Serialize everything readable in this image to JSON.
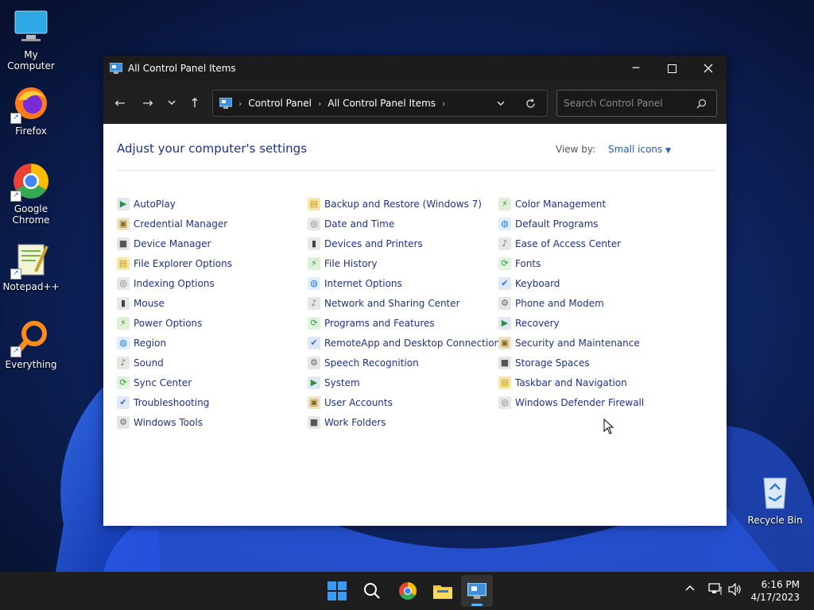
{
  "desktop": {
    "icons": [
      {
        "label": "My Computer"
      },
      {
        "label": "Firefox"
      },
      {
        "label": "Google Chrome"
      },
      {
        "label": "Notepad++"
      },
      {
        "label": "Everything"
      },
      {
        "label": "Recycle Bin"
      }
    ]
  },
  "window": {
    "title": "All Control Panel Items",
    "breadcrumb": [
      "Control Panel",
      "All Control Panel Items"
    ],
    "search_placeholder": "Search Control Panel"
  },
  "content": {
    "heading": "Adjust your computer's settings",
    "view_by_label": "View by:",
    "view_by_value": "Small icons",
    "columns": [
      [
        "AutoPlay",
        "Credential Manager",
        "Device Manager",
        "File Explorer Options",
        "Indexing Options",
        "Mouse",
        "Power Options",
        "Region",
        "Sound",
        "Sync Center",
        "Troubleshooting",
        "Windows Tools"
      ],
      [
        "Backup and Restore (Windows 7)",
        "Date and Time",
        "Devices and Printers",
        "File History",
        "Internet Options",
        "Network and Sharing Center",
        "Programs and Features",
        "RemoteApp and Desktop Connections",
        "Speech Recognition",
        "System",
        "User Accounts",
        "Work Folders"
      ],
      [
        "Color Management",
        "Default Programs",
        "Ease of Access Center",
        "Fonts",
        "Keyboard",
        "Phone and Modem",
        "Recovery",
        "Security and Maintenance",
        "Storage Spaces",
        "Taskbar and Navigation",
        "Windows Defender Firewall"
      ]
    ]
  },
  "taskbar": {
    "time": "6:16 PM",
    "date": "4/17/2023"
  },
  "colors": {
    "link": "#1e3287",
    "accent": "#1e5bb8",
    "titlebar": "#1c1c1c"
  }
}
